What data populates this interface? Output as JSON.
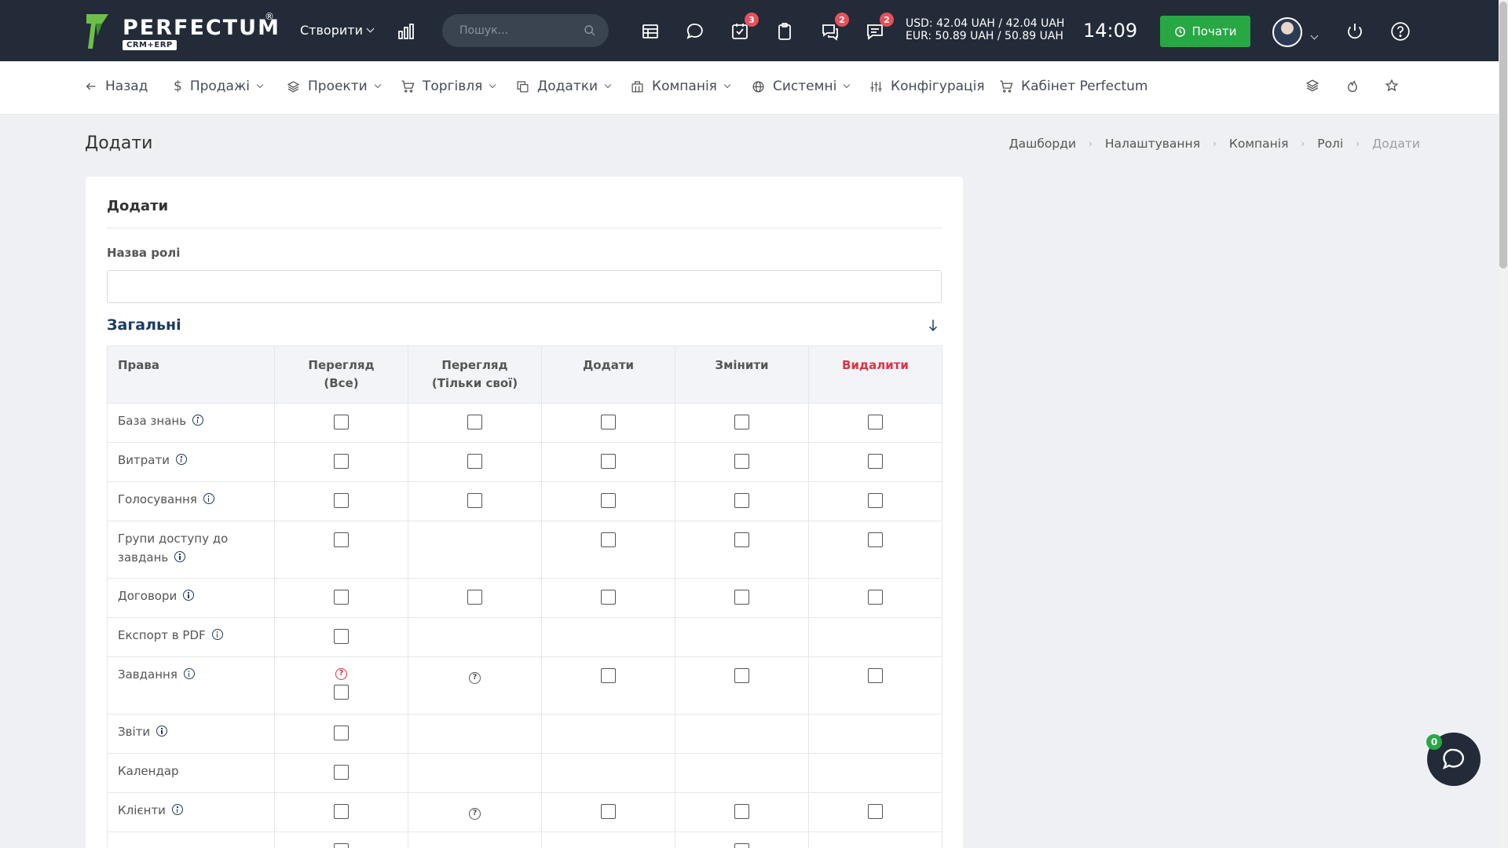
{
  "header": {
    "logo_text": "PERFECTUM",
    "logo_reg": "®",
    "logo_sub": "CRM+ERP",
    "create_label": "Створити",
    "search_placeholder": "Пошук...",
    "badges": {
      "tasks": "3",
      "chat": "2",
      "messages": "2"
    },
    "currency_usd": "USD: 42.04 UAH / 42.04 UAH",
    "currency_eur": "EUR: 50.89 UAH / 50.89 UAH",
    "time": "14:09",
    "start_label": "Почати",
    "colors": {
      "bg": "#232b38",
      "start": "#28a745",
      "badge": "#e8505b"
    }
  },
  "nav": {
    "items": [
      {
        "label": "Назад",
        "icon": "arrow-left-icon"
      },
      {
        "label": "Продажі",
        "icon": "dollar-icon"
      },
      {
        "label": "Проекти",
        "icon": "layers-icon"
      },
      {
        "label": "Торгівля",
        "icon": "cart-icon"
      },
      {
        "label": "Додатки",
        "icon": "copy-icon"
      },
      {
        "label": "Компанія",
        "icon": "building-icon"
      },
      {
        "label": "Системні",
        "icon": "globe-icon"
      },
      {
        "label": "Конфігурація",
        "icon": "sliders-icon"
      },
      {
        "label": "Кабінет Perfectum",
        "icon": "cart-icon"
      }
    ]
  },
  "page": {
    "title": "Додати",
    "breadcrumb": [
      "Дашборди",
      "Налаштування",
      "Компанія",
      "Ролі",
      "Додати"
    ]
  },
  "form": {
    "card_title": "Додати",
    "role_name_label": "Назва ролі",
    "role_name_value": "",
    "section_title": "Загальні"
  },
  "table": {
    "headers": {
      "rights": "Права",
      "view_all_1": "Перегляд",
      "view_all_2": "(Все)",
      "view_own_1": "Перегляд",
      "view_own_2": "(Тільки свої)",
      "add": "Додати",
      "edit": "Змінити",
      "delete": "Видалити"
    },
    "rows": [
      {
        "name": "База знань"
      },
      {
        "name": "Витрати"
      },
      {
        "name": "Голосування"
      },
      {
        "name": "Групи доступу до завдань"
      },
      {
        "name": "Договори"
      },
      {
        "name": "Експорт в PDF"
      },
      {
        "name": "Завдання"
      },
      {
        "name": "Звіти"
      },
      {
        "name": "Календар"
      },
      {
        "name": "Клієнти"
      },
      {
        "name": ""
      }
    ]
  },
  "chat": {
    "badge": "0"
  }
}
